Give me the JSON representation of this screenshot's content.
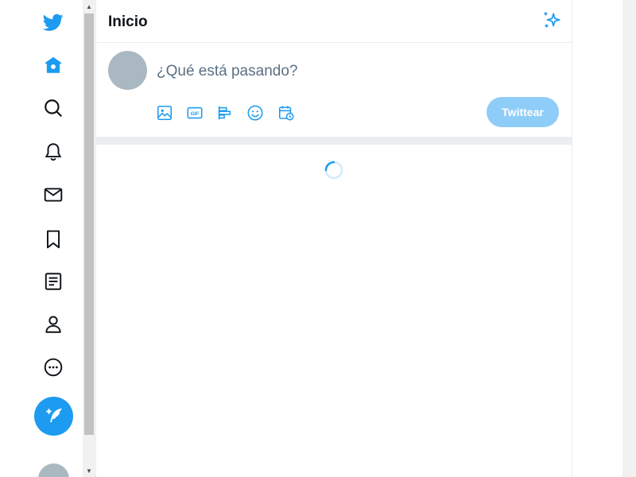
{
  "header": {
    "title": "Inicio",
    "sparkle_icon": "sparkle-icon"
  },
  "composer": {
    "placeholder": "¿Qué está pasando?",
    "tools": [
      "image-icon",
      "gif-icon",
      "poll-icon",
      "emoji-icon",
      "schedule-icon"
    ],
    "gif_label": "GIF",
    "submit_label": "Twittear"
  },
  "nav": {
    "items": [
      {
        "icon": "twitter-logo-icon"
      },
      {
        "icon": "home-icon"
      },
      {
        "icon": "search-icon"
      },
      {
        "icon": "bell-icon"
      },
      {
        "icon": "mail-icon"
      },
      {
        "icon": "bookmark-icon"
      },
      {
        "icon": "list-icon"
      },
      {
        "icon": "profile-icon"
      },
      {
        "icon": "more-icon"
      }
    ],
    "compose_icon": "compose-feather-icon"
  },
  "colors": {
    "accent": "#1d9bf0",
    "button_disabled": "#8ecdf8",
    "border": "#ebeef0",
    "avatar": "#aab8c2",
    "placeholder": "#5b7083"
  },
  "loading": true
}
